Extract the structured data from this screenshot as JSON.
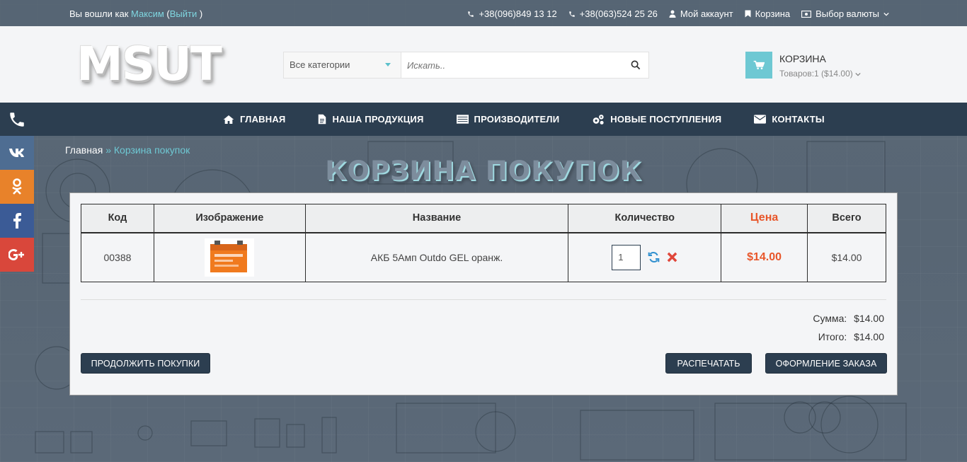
{
  "topbar": {
    "login_prefix": "Вы вошли как",
    "user_name": "Максим",
    "logout_open": "(",
    "logout_label": "Выйти",
    "logout_close": ")",
    "phone1": "+38(096)849 13 12",
    "phone2": "+38(063)524 25 26",
    "account_label": "Мой аккаунт",
    "cart_label": "Корзина",
    "currency_label": "Выбор валюты"
  },
  "header": {
    "logo_text": "MSUT",
    "search": {
      "category_selected": "Все категории",
      "placeholder": "Искать.."
    },
    "cart": {
      "title": "КОРЗИНА",
      "summary": "Товаров:1 ($14.00)"
    }
  },
  "nav": {
    "items": [
      {
        "label": "ГЛАВНАЯ",
        "icon": "home-icon"
      },
      {
        "label": "НАША ПРОДУКЦИЯ",
        "icon": "file-icon"
      },
      {
        "label": "ПРОИЗВОДИТЕЛИ",
        "icon": "list-icon"
      },
      {
        "label": "НОВЫЕ ПОСТУПЛЕНИЯ",
        "icon": "gears-icon"
      },
      {
        "label": "КОНТАКТЫ",
        "icon": "envelope-icon"
      }
    ]
  },
  "social": {
    "vk": "vk-icon",
    "ok": "odnoklassniki-icon",
    "fb": "facebook-icon",
    "gp": "google-plus-icon"
  },
  "breadcrumb": {
    "home": "Главная",
    "separator": "»",
    "current": "Корзина покупок"
  },
  "page_title": "КОРЗИНА ПОКУПОК",
  "cart_table": {
    "headers": {
      "code": "Код",
      "image": "Изображение",
      "name": "Название",
      "quantity": "Количество",
      "price": "Цена",
      "total": "Всего"
    },
    "rows": [
      {
        "code": "00388",
        "name": "АКБ 5Амп Outdo GEL оранж.",
        "quantity": "1",
        "price": "$14.00",
        "total": "$14.00"
      }
    ]
  },
  "totals": {
    "subtotal_label": "Сумма:",
    "subtotal_value": "$14.00",
    "total_label": "Итого:",
    "total_value": "$14.00"
  },
  "buttons": {
    "continue": "ПРОДОЛЖИТЬ ПОКУПКИ",
    "print": "РАСПЕЧАТАТЬ",
    "checkout": "ОФОРМЛЕНИЕ ЗАКАЗА"
  },
  "colors": {
    "nav_bg": "#2c3e50",
    "accent": "#6ec8d3",
    "price": "#e8562a",
    "remove": "#e0463a",
    "refresh": "#2f8fcf"
  }
}
